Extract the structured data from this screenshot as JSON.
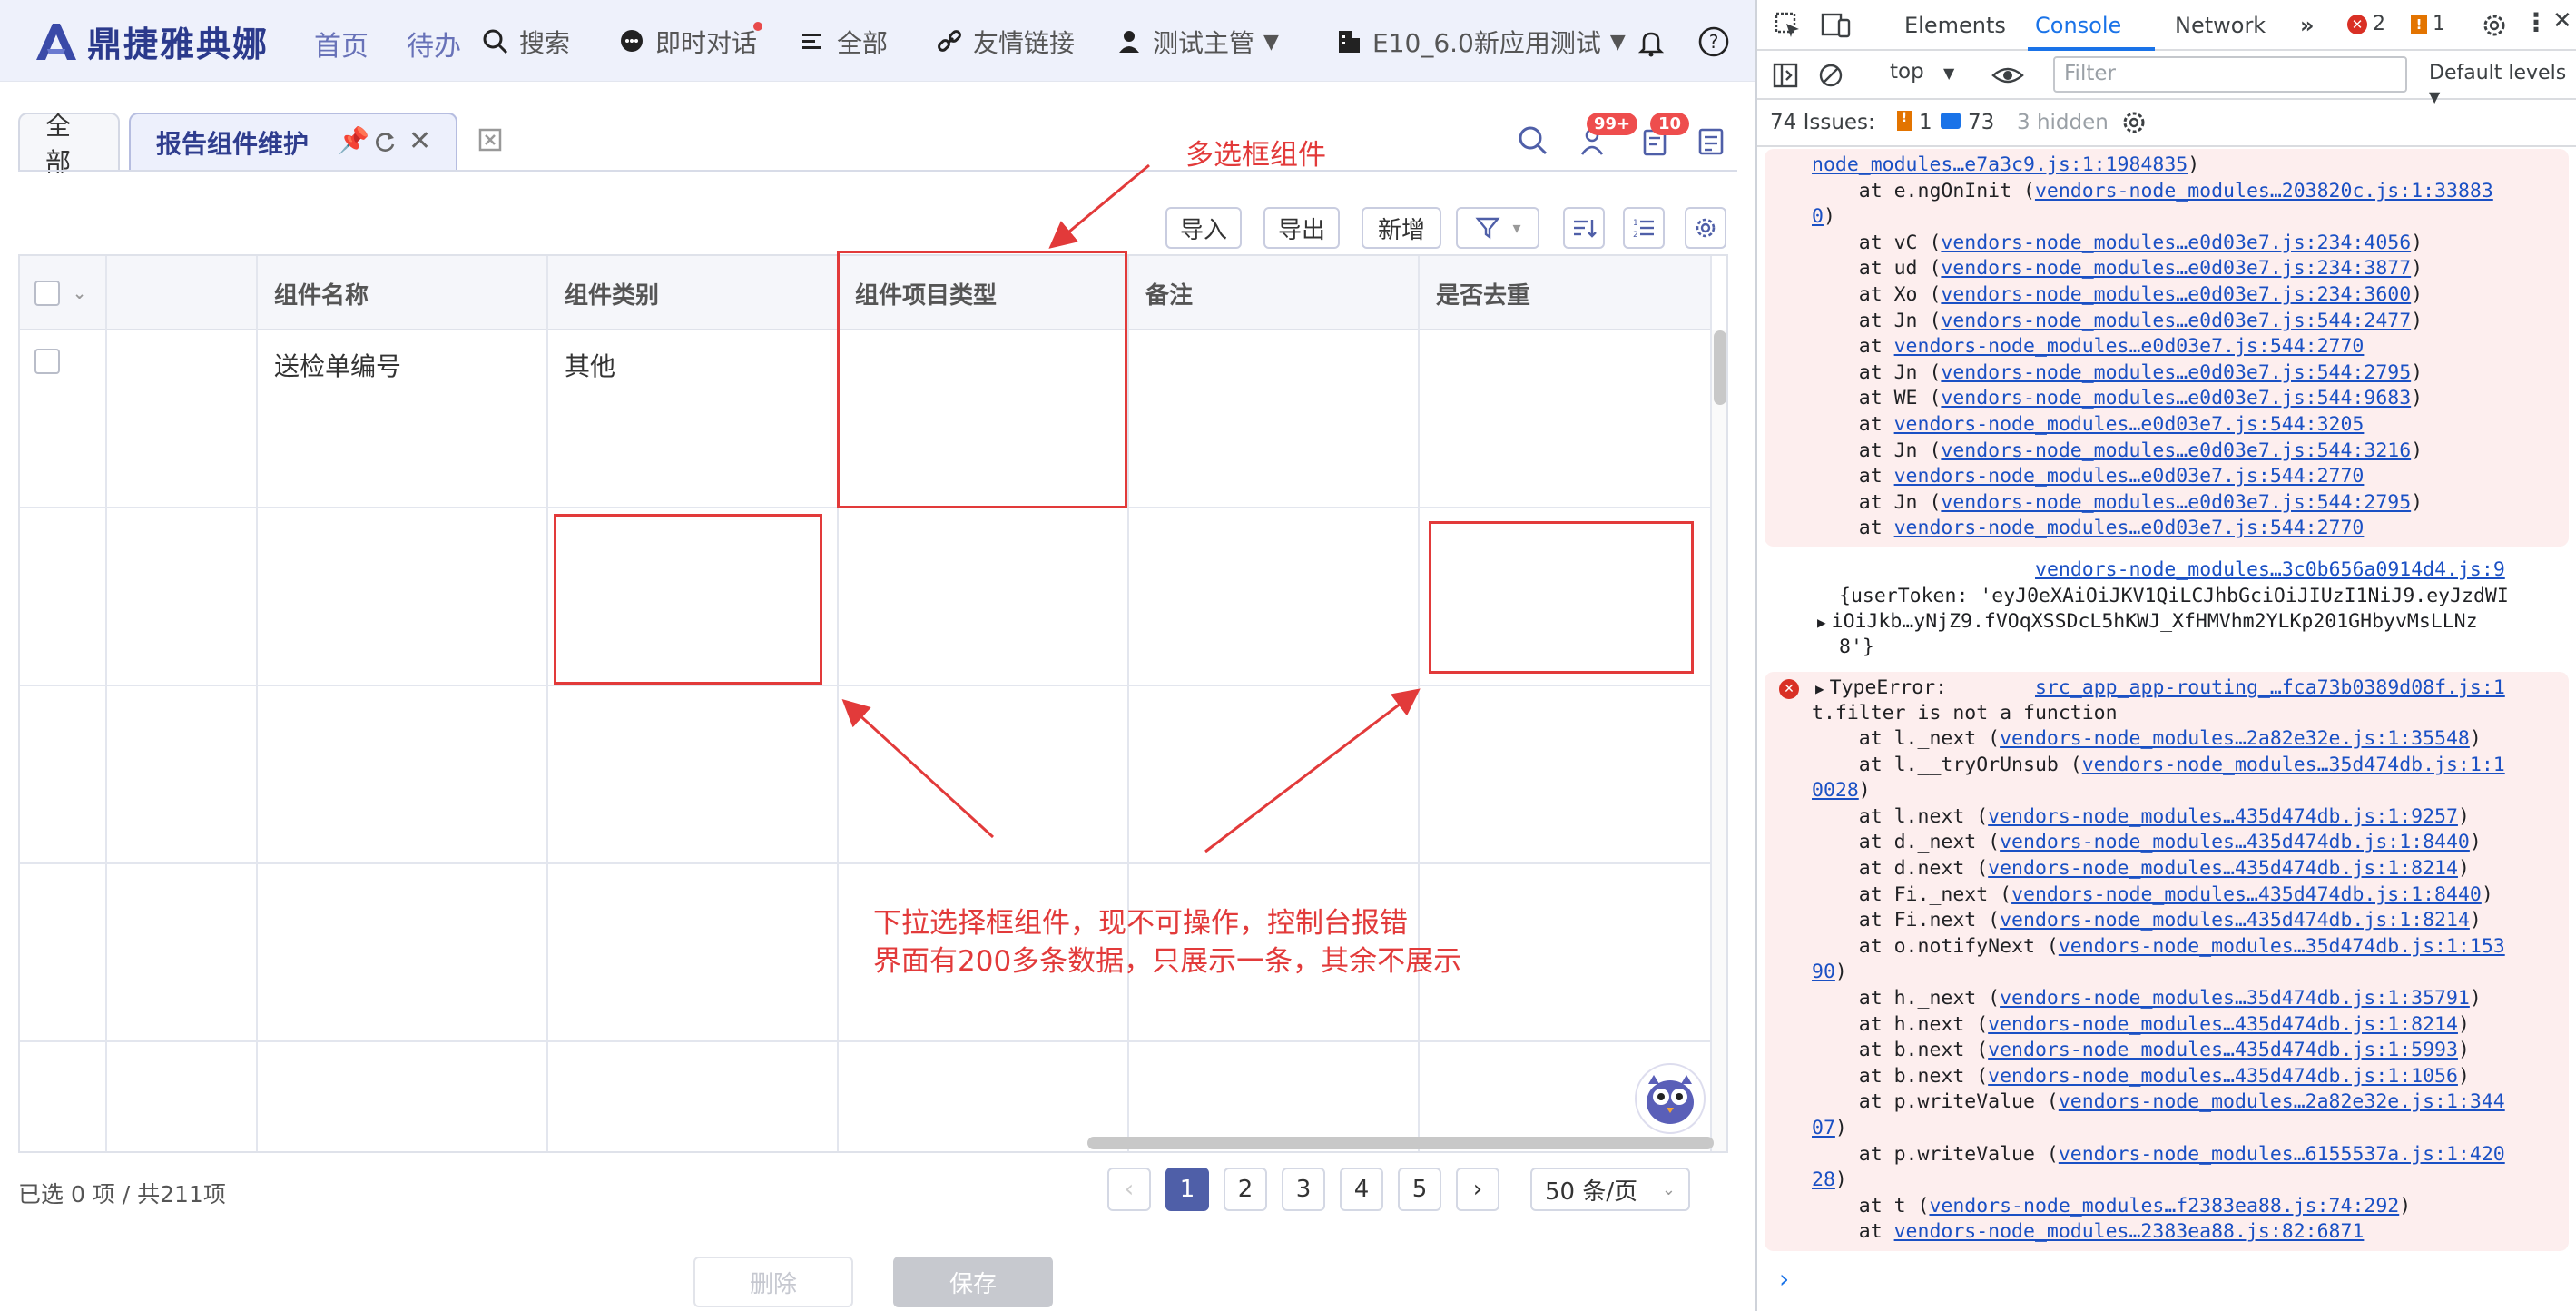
{
  "app": {
    "brand": "鼎捷雅典娜",
    "nav": {
      "home": "首页",
      "todo": "待办",
      "search": "搜索",
      "chat": "即时对话",
      "all": "全部",
      "links": "友情链接",
      "user": "测试主管",
      "env": "E10_6.0新应用测试"
    },
    "tabs": [
      {
        "label": "全部"
      },
      {
        "label": "报告组件维护"
      }
    ],
    "badges": {
      "bell": "99+",
      "task": "10"
    },
    "toolbar": {
      "import": "导入",
      "export": "导出",
      "add": "新增"
    },
    "table": {
      "columns": [
        "组件名称",
        "组件类别",
        "组件项目类型",
        "备注",
        "是否去重"
      ],
      "rows": [
        {
          "name": "送检单编号",
          "category": "其他",
          "item_type": "",
          "note": "",
          "dedup": ""
        }
      ]
    },
    "footer": {
      "selected": "已选 0 项 / 共211项",
      "pages": [
        "1",
        "2",
        "3",
        "4",
        "5"
      ],
      "page_size": "50 条/页",
      "delete": "删除",
      "save": "保存"
    },
    "annotations": {
      "top": "多选框组件",
      "bottom_line1": "下拉选择框组件，现不可操作，控制台报错",
      "bottom_line2": "界面有200多条数据，只展示一条，其余不展示"
    }
  },
  "devtools": {
    "tabs": [
      "Elements",
      "Console",
      "Network"
    ],
    "error_count": "2",
    "warn_count": "1",
    "context": "top",
    "filter_placeholder": "Filter",
    "levels": "Default levels",
    "issues": {
      "label": "74 Issues:",
      "warn": "1",
      "info": "73",
      "hidden": "3 hidden"
    },
    "block1": [
      {
        "pre": "",
        "link": "node_modules…e7a3c9.js:1:1984835",
        "post": ")"
      },
      {
        "pre": "    at e.ngOnInit (",
        "link": "vendors-node_modules…203820c.js:1:33883",
        "post": ""
      },
      {
        "pre": "",
        "link": "0",
        "post": ")"
      },
      {
        "pre": "    at vC (",
        "link": "vendors-node_modules…e0d03e7.js:234:4056",
        "post": ")"
      },
      {
        "pre": "    at ud (",
        "link": "vendors-node_modules…e0d03e7.js:234:3877",
        "post": ")"
      },
      {
        "pre": "    at Xo (",
        "link": "vendors-node_modules…e0d03e7.js:234:3600",
        "post": ")"
      },
      {
        "pre": "    at Jn (",
        "link": "vendors-node_modules…e0d03e7.js:544:2477",
        "post": ")"
      },
      {
        "pre": "    at ",
        "link": "vendors-node_modules…e0d03e7.js:544:2770",
        "post": ""
      },
      {
        "pre": "    at Jn (",
        "link": "vendors-node_modules…e0d03e7.js:544:2795",
        "post": ")"
      },
      {
        "pre": "    at WE (",
        "link": "vendors-node_modules…e0d03e7.js:544:9683",
        "post": ")"
      },
      {
        "pre": "    at ",
        "link": "vendors-node_modules…e0d03e7.js:544:3205",
        "post": ""
      },
      {
        "pre": "    at Jn (",
        "link": "vendors-node_modules…e0d03e7.js:544:3216",
        "post": ")"
      },
      {
        "pre": "    at ",
        "link": "vendors-node_modules…e0d03e7.js:544:2770",
        "post": ""
      },
      {
        "pre": "    at Jn (",
        "link": "vendors-node_modules…e0d03e7.js:544:2795",
        "post": ")"
      },
      {
        "pre": "    at ",
        "link": "vendors-node_modules…e0d03e7.js:544:2770",
        "post": ""
      }
    ],
    "token_source": "vendors-node_modules…3c0b656a0914d4.js:9",
    "token_line1": "{userToken: 'eyJ0eXAiOiJKV1QiLCJhbGciOiJIUzI1NiJ9.eyJzdWI",
    "token_line2": "iOiJkb…yNjZ9.fVOqXSSDcL5hKWJ_XfHMVhm2YLKp201GHbyvMsLLNz",
    "token_line3": "8'}",
    "error_head": "TypeError:",
    "error_source": "src_app_app-routing_…fca73b0389d08f.js:1",
    "error_msg": "t.filter is not a function",
    "block2": [
      {
        "pre": "    at l._next (",
        "link": "vendors-node_modules…2a82e32e.js:1:35548",
        "post": ")"
      },
      {
        "pre": "    at l.__tryOrUnsub (",
        "link": "vendors-node_modules…35d474db.js:1:1",
        "post": ""
      },
      {
        "pre": "",
        "link": "0028",
        "post": ")"
      },
      {
        "pre": "    at l.next (",
        "link": "vendors-node_modules…435d474db.js:1:9257",
        "post": ")"
      },
      {
        "pre": "    at d._next (",
        "link": "vendors-node_modules…435d474db.js:1:8440",
        "post": ")"
      },
      {
        "pre": "    at d.next (",
        "link": "vendors-node_modules…435d474db.js:1:8214",
        "post": ")"
      },
      {
        "pre": "    at Fi._next (",
        "link": "vendors-node_modules…435d474db.js:1:8440",
        "post": ")"
      },
      {
        "pre": "    at Fi.next (",
        "link": "vendors-node_modules…435d474db.js:1:8214",
        "post": ")"
      },
      {
        "pre": "    at o.notifyNext (",
        "link": "vendors-node_modules…35d474db.js:1:153",
        "post": ""
      },
      {
        "pre": "",
        "link": "90",
        "post": ")"
      },
      {
        "pre": "    at h._next (",
        "link": "vendors-node_modules…35d474db.js:1:35791",
        "post": ")"
      },
      {
        "pre": "    at h.next (",
        "link": "vendors-node_modules…435d474db.js:1:8214",
        "post": ")"
      },
      {
        "pre": "    at b.next (",
        "link": "vendors-node_modules…435d474db.js:1:5993",
        "post": ")"
      },
      {
        "pre": "    at b.next (",
        "link": "vendors-node_modules…435d474db.js:1:1056",
        "post": ")"
      },
      {
        "pre": "    at p.writeValue (",
        "link": "vendors-node_modules…2a82e32e.js:1:344",
        "post": ""
      },
      {
        "pre": "",
        "link": "07",
        "post": ")"
      },
      {
        "pre": "    at p.writeValue (",
        "link": "vendors-node_modules…6155537a.js:1:420",
        "post": ""
      },
      {
        "pre": "",
        "link": "28",
        "post": ")"
      },
      {
        "pre": "    at t (",
        "link": "vendors-node_modules…f2383ea88.js:74:292",
        "post": ")"
      },
      {
        "pre": "    at ",
        "link": "vendors-node_modules…2383ea88.js:82:6871",
        "post": ""
      }
    ],
    "prompt": "›"
  },
  "colors": {
    "accent": "#4f5fa8",
    "annotation": "#e23a3a",
    "console_blue": "#1a73e8"
  }
}
